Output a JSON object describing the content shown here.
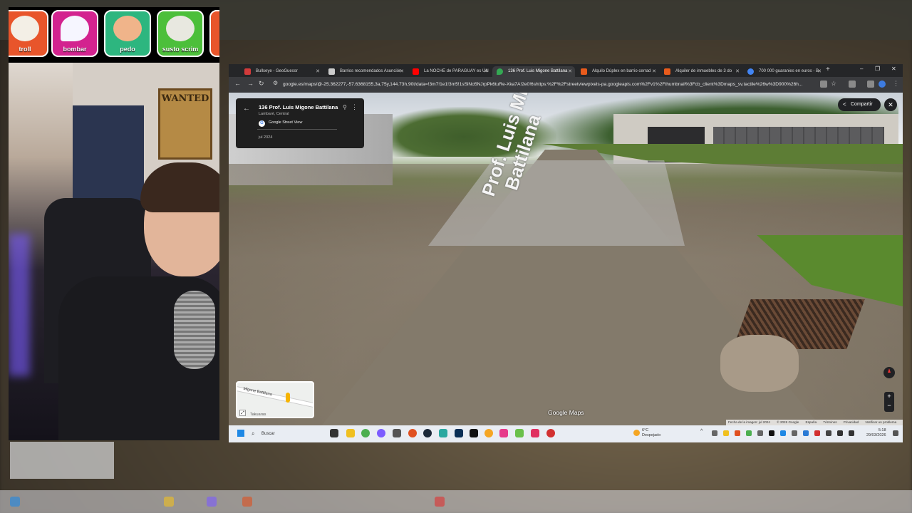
{
  "stream": {
    "sound_buttons": [
      {
        "label": "troll",
        "color": "#e8552b"
      },
      {
        "label": "bombar",
        "color": "#d3238f"
      },
      {
        "label": "pedo",
        "color": "#2db67f"
      },
      {
        "label": "susto scrim",
        "color": "#4cbf3a"
      }
    ],
    "poster_text": "WANTED"
  },
  "browser": {
    "tabs": [
      {
        "title": "Bullseye - GeoGuessr",
        "favicon_color": "#d23b3b",
        "active": false
      },
      {
        "title": "Barrios recomendados Asunción",
        "favicon_color": "#cccccc",
        "active": false
      },
      {
        "title": "La NOCHE de PARAGUAY es ÚN",
        "favicon_color": "#ff0000",
        "active": false
      },
      {
        "title": "136 Prof. Luis Migone Battilana",
        "favicon_color": "#34a853",
        "active": true
      },
      {
        "title": "Alquilo Dúplex en barrio cerrad",
        "favicon_color": "#e85b1c",
        "active": false
      },
      {
        "title": "Alquiler de inmuebles de 3 do",
        "favicon_color": "#e85b1c",
        "active": false
      },
      {
        "title": "700 000 guaranies en euros - B",
        "favicon_color": "#4285f4",
        "active": false
      }
    ],
    "url": "google.es/maps/@-25.362277,-57.6368155,3a,75y,144.73h,90t/data=!3m7!1e1!3m5!1sSlNo5NJrpPk6tuRe-Xka7A!2e0!6shttps:%2F%2Fstreetviewpixels-pa.googleapis.com%2Fv1%2Fthumbnail%3Fcb_client%3Dmaps_sv.tactile%26w%3D900%26h..."
  },
  "streetview": {
    "place_title": "136 Prof. Luis Migone Battilana",
    "place_subtitle": "Lambaré, Central",
    "source": "Google Street View",
    "date": "jul 2024",
    "share_label": "Compartir",
    "street_line1": "Prof. Luis Migone",
    "street_line2": "Battilana",
    "watermark": "Google Maps",
    "minimap_street": "Migone Battilana",
    "minimap_place": "Takuaras",
    "footer": [
      "Fecha de la imagen: jul 2024",
      "© 2026 Google",
      "España",
      "Términos",
      "Privacidad",
      "Notificar un problema"
    ]
  },
  "taskbar": {
    "search_placeholder": "Buscar",
    "weather_temp": "6°C",
    "weather_desc": "Despejado",
    "time": "5:18",
    "date": "29/03/2026"
  }
}
